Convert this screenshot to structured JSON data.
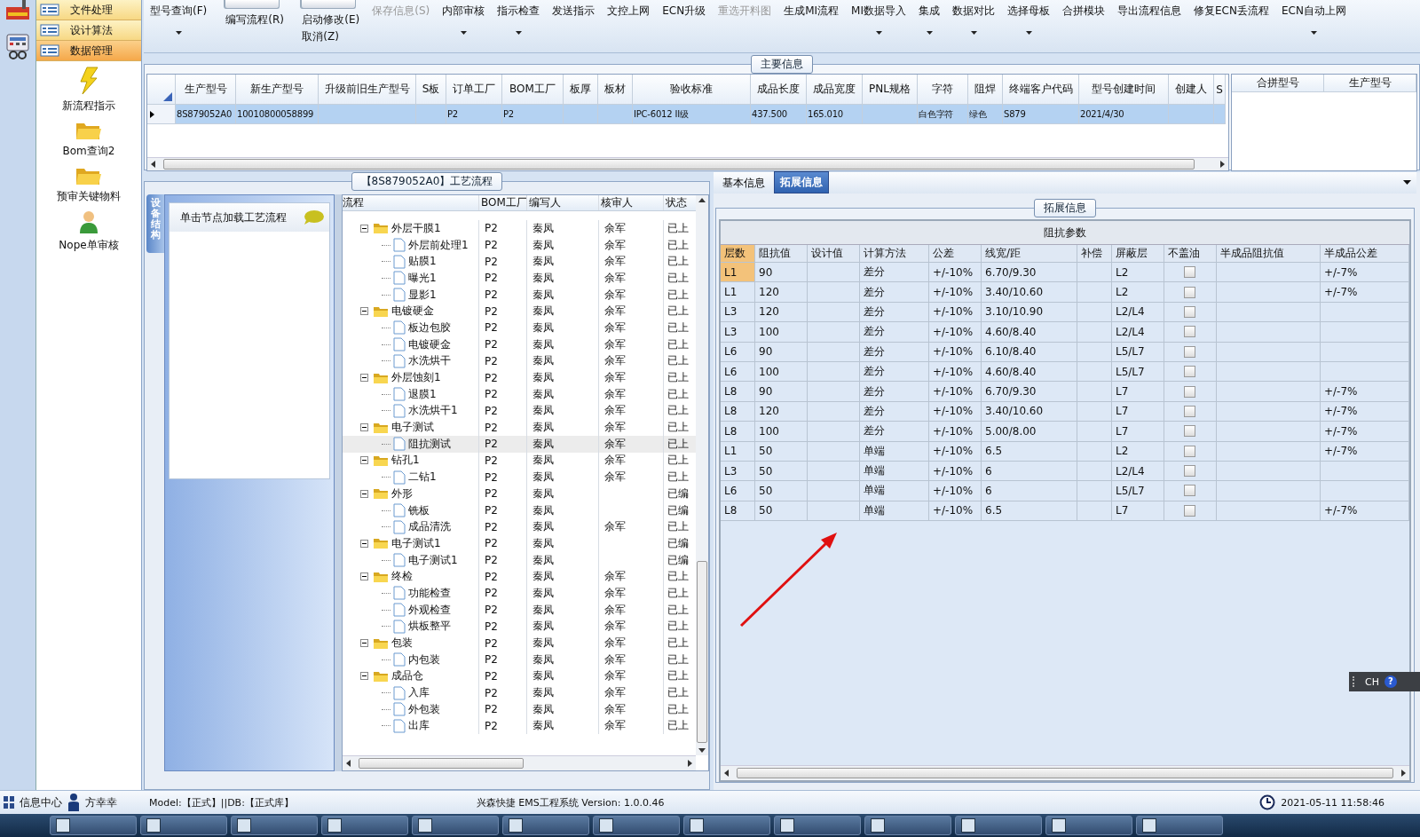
{
  "nav": {
    "items": [
      {
        "label": "文件处理",
        "selected": false
      },
      {
        "label": "设计算法",
        "selected": false
      },
      {
        "label": "数据管理",
        "selected": true
      }
    ],
    "shortcuts": [
      {
        "label": "新流程指示",
        "kind": "lightning"
      },
      {
        "label": "Bom查询2",
        "kind": "folder"
      },
      {
        "label": "预审关键物料",
        "kind": "folder"
      },
      {
        "label": "Nope单审核",
        "kind": "person"
      }
    ]
  },
  "toolbar": [
    {
      "label": "型号查询(F)",
      "kind": "button",
      "dropdown": true,
      "disabled": false
    },
    {
      "label": "编写流程(R)",
      "kind": "toggle",
      "on": false,
      "dropdown": false,
      "disabled": false
    },
    {
      "label": "启动修改(E)",
      "secondary": "取消(Z)",
      "kind": "toggle",
      "on": false,
      "dropdown": false,
      "disabled": false
    },
    {
      "label": "保存信息(S)",
      "kind": "button",
      "dropdown": false,
      "disabled": true
    },
    {
      "label": "内部审核",
      "kind": "button",
      "dropdown": true,
      "disabled": false
    },
    {
      "label": "指示检查",
      "kind": "button",
      "dropdown": true,
      "disabled": false
    },
    {
      "label": "发送指示",
      "kind": "button",
      "dropdown": false,
      "disabled": false
    },
    {
      "label": "文控上网",
      "kind": "button",
      "dropdown": false,
      "disabled": false
    },
    {
      "label": "ECN升级",
      "kind": "button",
      "dropdown": false,
      "disabled": false
    },
    {
      "label": "重选开料图",
      "kind": "button",
      "dropdown": false,
      "disabled": true
    },
    {
      "label": "生成MI流程",
      "kind": "button",
      "dropdown": false,
      "disabled": false
    },
    {
      "label": "MI数据导入",
      "kind": "button",
      "dropdown": true,
      "disabled": false
    },
    {
      "label": "集成",
      "kind": "button",
      "dropdown": true,
      "disabled": false
    },
    {
      "label": "数据对比",
      "kind": "button",
      "dropdown": true,
      "disabled": false
    },
    {
      "label": "选择母板",
      "kind": "button",
      "dropdown": true,
      "disabled": false
    },
    {
      "label": "合拼模块",
      "kind": "button",
      "dropdown": false,
      "disabled": false
    },
    {
      "label": "导出流程信息",
      "kind": "button",
      "dropdown": false,
      "disabled": false
    },
    {
      "label": "修复ECN丢流程",
      "kind": "button",
      "dropdown": false,
      "disabled": false
    },
    {
      "label": "ECN自动上网",
      "kind": "button",
      "dropdown": true,
      "disabled": false
    }
  ],
  "main_info": {
    "title": "主要信息",
    "columns": [
      "生产型号",
      "新生产型号",
      "升级前旧生产型号",
      "S板",
      "订单工厂",
      "BOM工厂",
      "板厚",
      "板材",
      "验收标准",
      "成品长度",
      "成品宽度",
      "PNL规格",
      "字符",
      "阻焊",
      "终端客户代码",
      "型号创建时间",
      "创建人",
      "S"
    ],
    "rows": [
      {
        "selected": true,
        "cells": [
          "8S879052A0",
          "10010800058899",
          null,
          null,
          "P2",
          "P2",
          null,
          null,
          "IPC-6012 II级",
          "437.500",
          "165.010",
          null,
          "白色字符",
          "绿色",
          "S879",
          "2021/4/30",
          null,
          null
        ]
      }
    ],
    "merge_grid": {
      "columns": [
        "合拼型号",
        "生产型号"
      ]
    }
  },
  "process": {
    "title": "【8S879052A0】工艺流程",
    "side_tab": "设备结构",
    "hint": "单击节点加载工艺流程",
    "columns": [
      "流程",
      "BOM工厂",
      "编写人",
      "核审人",
      "状态"
    ],
    "tree": [
      {
        "name": "外层干膜1",
        "bom_factory": "P2",
        "writer": "秦凤",
        "reviewer": "余军",
        "status": "已上",
        "selected": false,
        "expanded": true,
        "children": [
          {
            "name": "外层前处理1",
            "bom_factory": "P2",
            "writer": "秦凤",
            "reviewer": "余军",
            "status": "已上",
            "selected": false
          },
          {
            "name": "贴膜1",
            "bom_factory": "P2",
            "writer": "秦凤",
            "reviewer": "余军",
            "status": "已上",
            "selected": false
          },
          {
            "name": "曝光1",
            "bom_factory": "P2",
            "writer": "秦凤",
            "reviewer": "余军",
            "status": "已上",
            "selected": false
          },
          {
            "name": "显影1",
            "bom_factory": "P2",
            "writer": "秦凤",
            "reviewer": "余军",
            "status": "已上",
            "selected": false
          }
        ]
      },
      {
        "name": "电镀硬金",
        "bom_factory": "P2",
        "writer": "秦凤",
        "reviewer": "余军",
        "status": "已上",
        "selected": false,
        "expanded": true,
        "children": [
          {
            "name": "板边包胶",
            "bom_factory": "P2",
            "writer": "秦凤",
            "reviewer": "余军",
            "status": "已上",
            "selected": false
          },
          {
            "name": "电镀硬金",
            "bom_factory": "P2",
            "writer": "秦凤",
            "reviewer": "余军",
            "status": "已上",
            "selected": false
          },
          {
            "name": "水洗烘干",
            "bom_factory": "P2",
            "writer": "秦凤",
            "reviewer": "余军",
            "status": "已上",
            "selected": false
          }
        ]
      },
      {
        "name": "外层蚀刻1",
        "bom_factory": "P2",
        "writer": "秦凤",
        "reviewer": "余军",
        "status": "已上",
        "selected": false,
        "expanded": true,
        "children": [
          {
            "name": "退膜1",
            "bom_factory": "P2",
            "writer": "秦凤",
            "reviewer": "余军",
            "status": "已上",
            "selected": false
          },
          {
            "name": "水洗烘干1",
            "bom_factory": "P2",
            "writer": "秦凤",
            "reviewer": "余军",
            "status": "已上",
            "selected": false
          }
        ]
      },
      {
        "name": "电子测试",
        "bom_factory": "P2",
        "writer": "秦凤",
        "reviewer": "余军",
        "status": "已上",
        "selected": false,
        "expanded": true,
        "children": [
          {
            "name": "阻抗测试",
            "bom_factory": "P2",
            "writer": "秦凤",
            "reviewer": "余军",
            "status": "已上",
            "selected": true
          }
        ]
      },
      {
        "name": "钻孔1",
        "bom_factory": "P2",
        "writer": "秦凤",
        "reviewer": "余军",
        "status": "已上",
        "selected": false,
        "expanded": true,
        "children": [
          {
            "name": "二钻1",
            "bom_factory": "P2",
            "writer": "秦凤",
            "reviewer": "余军",
            "status": "已上",
            "selected": false
          }
        ]
      },
      {
        "name": "外形",
        "bom_factory": "P2",
        "writer": "秦凤",
        "status": "已编",
        "selected": false,
        "expanded": true,
        "children": [
          {
            "name": "铣板",
            "bom_factory": "P2",
            "writer": "秦凤",
            "status": "已编",
            "selected": false
          },
          {
            "name": "成品清洗",
            "bom_factory": "P2",
            "writer": "秦凤",
            "reviewer": "余军",
            "status": "已上",
            "selected": false
          }
        ]
      },
      {
        "name": "电子测试1",
        "bom_factory": "P2",
        "writer": "秦凤",
        "status": "已编",
        "selected": false,
        "expanded": true,
        "children": [
          {
            "name": "电子测试1",
            "bom_factory": "P2",
            "writer": "秦凤",
            "status": "已编",
            "selected": false
          }
        ]
      },
      {
        "name": "终检",
        "bom_factory": "P2",
        "writer": "秦凤",
        "reviewer": "余军",
        "status": "已上",
        "selected": false,
        "expanded": true,
        "children": [
          {
            "name": "功能检查",
            "bom_factory": "P2",
            "writer": "秦凤",
            "reviewer": "余军",
            "status": "已上",
            "selected": false
          },
          {
            "name": "外观检查",
            "bom_factory": "P2",
            "writer": "秦凤",
            "reviewer": "余军",
            "status": "已上",
            "selected": false
          },
          {
            "name": "烘板整平",
            "bom_factory": "P2",
            "writer": "秦凤",
            "reviewer": "余军",
            "status": "已上",
            "selected": false
          }
        ]
      },
      {
        "name": "包装",
        "bom_factory": "P2",
        "writer": "秦凤",
        "reviewer": "余军",
        "status": "已上",
        "selected": false,
        "expanded": true,
        "children": [
          {
            "name": "内包装",
            "bom_factory": "P2",
            "writer": "秦凤",
            "reviewer": "余军",
            "status": "已上",
            "selected": false
          }
        ]
      },
      {
        "name": "成品仓",
        "bom_factory": "P2",
        "writer": "秦凤",
        "reviewer": "余军",
        "status": "已上",
        "selected": false,
        "expanded": true,
        "children": [
          {
            "name": "入库",
            "bom_factory": "P2",
            "writer": "秦凤",
            "reviewer": "余军",
            "status": "已上",
            "selected": false
          },
          {
            "name": "外包装",
            "bom_factory": "P2",
            "writer": "秦凤",
            "reviewer": "余军",
            "status": "已上",
            "selected": false
          },
          {
            "name": "出库",
            "bom_factory": "P2",
            "writer": "秦凤",
            "reviewer": "余军",
            "status": "已上",
            "selected": false
          }
        ]
      }
    ]
  },
  "detail": {
    "tabs": [
      {
        "label": "基本信息",
        "selected": false
      },
      {
        "label": "拓展信息",
        "selected": true
      }
    ],
    "group_title": "拓展信息",
    "table_title": "阻抗参数",
    "columns": [
      {
        "label": "层数",
        "kind": "text"
      },
      {
        "label": "阻抗值",
        "kind": "text"
      },
      {
        "label": "设计值",
        "kind": "text"
      },
      {
        "label": "计算方法",
        "kind": "text"
      },
      {
        "label": "公差",
        "kind": "text"
      },
      {
        "label": "线宽/距",
        "kind": "text"
      },
      {
        "label": "补偿",
        "kind": "text"
      },
      {
        "label": "屏蔽层",
        "kind": "text"
      },
      {
        "label": "不盖油",
        "kind": "checkbox"
      },
      {
        "label": "半成品阻抗值",
        "kind": "text"
      },
      {
        "label": "半成品公差",
        "kind": "text"
      }
    ],
    "rows": [
      {
        "selected": true,
        "no_cover_oil": false,
        "cells": [
          "L1",
          "90",
          null,
          "差分",
          "+/-10%",
          "6.70/9.30",
          null,
          "L2",
          null,
          null,
          "+/-7%"
        ]
      },
      {
        "selected": false,
        "no_cover_oil": false,
        "cells": [
          "L1",
          "120",
          null,
          "差分",
          "+/-10%",
          "3.40/10.60",
          null,
          "L2",
          null,
          null,
          "+/-7%"
        ]
      },
      {
        "selected": false,
        "no_cover_oil": false,
        "cells": [
          "L3",
          "120",
          null,
          "差分",
          "+/-10%",
          "3.10/10.90",
          null,
          "L2/L4",
          null,
          null,
          null
        ]
      },
      {
        "selected": false,
        "no_cover_oil": false,
        "cells": [
          "L3",
          "100",
          null,
          "差分",
          "+/-10%",
          "4.60/8.40",
          null,
          "L2/L4",
          null,
          null,
          null
        ]
      },
      {
        "selected": false,
        "no_cover_oil": false,
        "cells": [
          "L6",
          "90",
          null,
          "差分",
          "+/-10%",
          "6.10/8.40",
          null,
          "L5/L7",
          null,
          null,
          null
        ]
      },
      {
        "selected": false,
        "no_cover_oil": false,
        "cells": [
          "L6",
          "100",
          null,
          "差分",
          "+/-10%",
          "4.60/8.40",
          null,
          "L5/L7",
          null,
          null,
          null
        ]
      },
      {
        "selected": false,
        "no_cover_oil": false,
        "cells": [
          "L8",
          "90",
          null,
          "差分",
          "+/-10%",
          "6.70/9.30",
          null,
          "L7",
          null,
          null,
          "+/-7%"
        ]
      },
      {
        "selected": false,
        "no_cover_oil": false,
        "cells": [
          "L8",
          "120",
          null,
          "差分",
          "+/-10%",
          "3.40/10.60",
          null,
          "L7",
          null,
          null,
          "+/-7%"
        ]
      },
      {
        "selected": false,
        "no_cover_oil": false,
        "cells": [
          "L8",
          "100",
          null,
          "差分",
          "+/-10%",
          "5.00/8.00",
          null,
          "L7",
          null,
          null,
          "+/-7%"
        ]
      },
      {
        "selected": false,
        "no_cover_oil": false,
        "cells": [
          "L1",
          "50",
          null,
          "单端",
          "+/-10%",
          "6.5",
          null,
          "L2",
          null,
          null,
          "+/-7%"
        ]
      },
      {
        "selected": false,
        "no_cover_oil": false,
        "cells": [
          "L3",
          "50",
          null,
          "单端",
          "+/-10%",
          "6",
          null,
          "L2/L4",
          null,
          null,
          null
        ]
      },
      {
        "selected": false,
        "no_cover_oil": false,
        "cells": [
          "L6",
          "50",
          null,
          "单端",
          "+/-10%",
          "6",
          null,
          "L5/L7",
          null,
          null,
          null
        ]
      },
      {
        "selected": false,
        "no_cover_oil": false,
        "cells": [
          "L8",
          "50",
          null,
          "单端",
          "+/-10%",
          "6.5",
          null,
          "L7",
          null,
          null,
          "+/-7%"
        ]
      }
    ]
  },
  "ime": {
    "language": "CH",
    "help": "?"
  },
  "status_bar": {
    "info_center": "信息中心",
    "user": "方幸幸",
    "environment": "Model:【正式】||DB:【正式库】",
    "app": "兴森快捷 EMS工程系统 Version: 1.0.0.46",
    "clock": "2021-05-11 11:58:46"
  }
}
